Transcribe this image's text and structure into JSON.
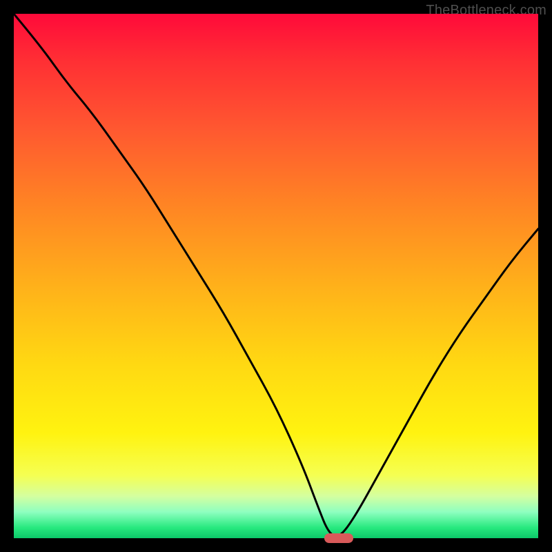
{
  "watermark": "TheBottleneck.com",
  "colors": {
    "frame": "#000000",
    "gradient_top": "#ff0a3a",
    "gradient_bottom": "#0cc96a",
    "curve": "#000000",
    "marker": "#d85a5a"
  },
  "chart_data": {
    "type": "line",
    "title": "",
    "xlabel": "",
    "ylabel": "",
    "xlim": [
      0,
      100
    ],
    "ylim": [
      0,
      100
    ],
    "grid": false,
    "legend": false,
    "series": [
      {
        "name": "bottleneck-curve",
        "x": [
          0,
          5,
          10,
          15,
          20,
          25,
          30,
          35,
          40,
          45,
          50,
          55,
          58,
          60,
          62,
          65,
          70,
          75,
          80,
          85,
          90,
          95,
          100
        ],
        "y": [
          100,
          94,
          87,
          81,
          74,
          67,
          59,
          51,
          43,
          34,
          25,
          14,
          6,
          1,
          0,
          4,
          13,
          22,
          31,
          39,
          46,
          53,
          59
        ]
      }
    ],
    "annotations": [
      {
        "name": "min-marker",
        "x": 62,
        "y": 0,
        "shape": "pill",
        "color": "#d85a5a"
      }
    ],
    "background_gradient": {
      "direction": "vertical",
      "stops": [
        {
          "pos": 0.0,
          "color": "#ff0a3a"
        },
        {
          "pos": 0.22,
          "color": "#ff5830"
        },
        {
          "pos": 0.52,
          "color": "#ffb11a"
        },
        {
          "pos": 0.8,
          "color": "#fff310"
        },
        {
          "pos": 0.95,
          "color": "#8effc0"
        },
        {
          "pos": 1.0,
          "color": "#0cc96a"
        }
      ]
    }
  }
}
